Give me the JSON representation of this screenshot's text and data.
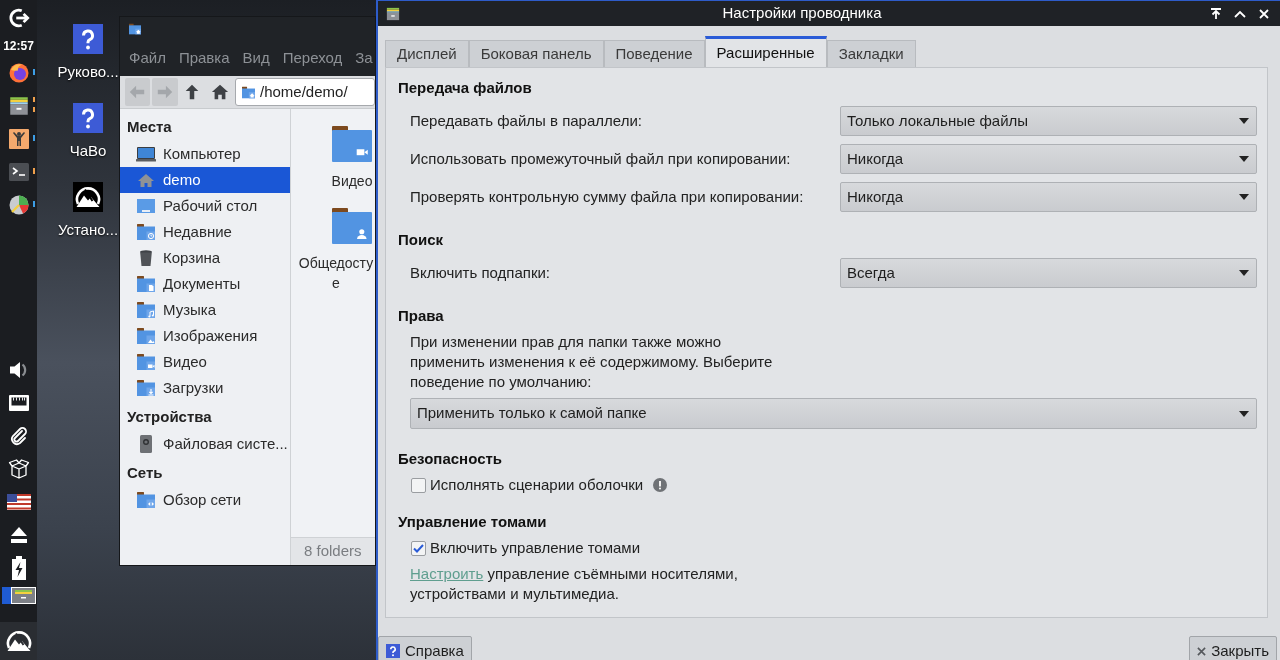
{
  "panel": {
    "clock": "12:57",
    "launchers": [
      {
        "kind": "browser",
        "color": "#3d9ee6"
      },
      {
        "kind": "files",
        "color": "#f0a04b"
      },
      {
        "kind": "person",
        "color": "#3d9ee6"
      },
      {
        "kind": "terminal",
        "color": "#f0a04b"
      },
      {
        "kind": "chart",
        "color": "#3d9ee6"
      }
    ]
  },
  "desktop_icons": [
    {
      "kind": "help",
      "label": "Руково..."
    },
    {
      "kind": "help",
      "label": "ЧаВо"
    },
    {
      "kind": "installer",
      "label": "Устано..."
    }
  ],
  "file_manager": {
    "menu": [
      "Файл",
      "Правка",
      "Вид",
      "Переход",
      "За"
    ],
    "toolbar": [
      {
        "kind": "back",
        "disabled": true
      },
      {
        "kind": "forward",
        "disabled": true
      },
      {
        "kind": "up",
        "disabled": false
      },
      {
        "kind": "home",
        "disabled": false
      }
    ],
    "address": "/home/demo/",
    "sidebar": [
      {
        "heading": "Места",
        "items": [
          {
            "kind": "computer",
            "label": "Компьютер",
            "selected": false
          },
          {
            "kind": "home",
            "label": "demo",
            "selected": true
          },
          {
            "kind": "desktop",
            "label": "Рабочий стол",
            "selected": false
          },
          {
            "kind": "recent",
            "label": "Недавние",
            "selected": false
          },
          {
            "kind": "trash",
            "label": "Корзина",
            "selected": false
          },
          {
            "kind": "documents",
            "label": "Документы",
            "selected": false
          },
          {
            "kind": "music",
            "label": "Музыка",
            "selected": false
          },
          {
            "kind": "pictures",
            "label": "Изображения",
            "selected": false
          },
          {
            "kind": "videos",
            "label": "Видео",
            "selected": false
          },
          {
            "kind": "downloads",
            "label": "Загрузки",
            "selected": false
          }
        ]
      },
      {
        "heading": "Устройства",
        "items": [
          {
            "kind": "drive",
            "label": "Файловая систе...",
            "selected": false
          }
        ]
      },
      {
        "heading": "Сеть",
        "items": [
          {
            "kind": "network",
            "label": "Обзор сети",
            "selected": false
          }
        ]
      }
    ],
    "files": [
      {
        "kind": "videos",
        "label": [
          "Видео"
        ]
      },
      {
        "kind": "public",
        "label": [
          "Общедосту",
          "е"
        ]
      }
    ],
    "status": "8 folders"
  },
  "dialog": {
    "title": "Настройки проводника",
    "tabs": [
      {
        "label": "Дисплей",
        "selected": false
      },
      {
        "label": "Боковая панель",
        "selected": false
      },
      {
        "label": "Поведение",
        "selected": false
      },
      {
        "label": "Расширенные",
        "selected": true
      },
      {
        "label": "Закладки",
        "selected": false
      }
    ],
    "sections": [
      {
        "heading": "Передача файлов",
        "rows": [
          {
            "kind": "select",
            "label": "Передавать файлы в параллели:",
            "value": "Только локальные файлы"
          },
          {
            "kind": "select",
            "label": "Использовать промежуточный файл при копировании:",
            "value": "Никогда"
          },
          {
            "kind": "select",
            "label": "Проверять контрольную сумму файла при копировании:",
            "value": "Никогда"
          }
        ]
      },
      {
        "heading": "Поиск",
        "rows": [
          {
            "kind": "select",
            "label": "Включить подпапки:",
            "value": "Всегда"
          }
        ]
      },
      {
        "heading": "Права",
        "rows": [
          {
            "kind": "paragraph",
            "text": "При изменении прав для папки также можно применить изменения к её содержимому. Выберите поведение по умолчанию:"
          },
          {
            "kind": "dropdown",
            "value": "Применить только к самой папке"
          }
        ]
      },
      {
        "heading": "Безопасность",
        "rows": [
          {
            "kind": "checkbox",
            "label": "Исполнять сценарии оболочки",
            "checked": false,
            "warning": true
          }
        ]
      },
      {
        "heading": "Управление томами",
        "rows": [
          {
            "kind": "checkbox",
            "label": "Включить управление томами",
            "checked": true
          },
          {
            "kind": "note",
            "link": "Настроить",
            "text": "управление съёмными носителями, устройствами и мультимедиа."
          }
        ]
      }
    ],
    "buttons": [
      {
        "kind": "help",
        "label": "Справка"
      },
      {
        "kind": "close",
        "label": "Закрыть"
      }
    ]
  }
}
